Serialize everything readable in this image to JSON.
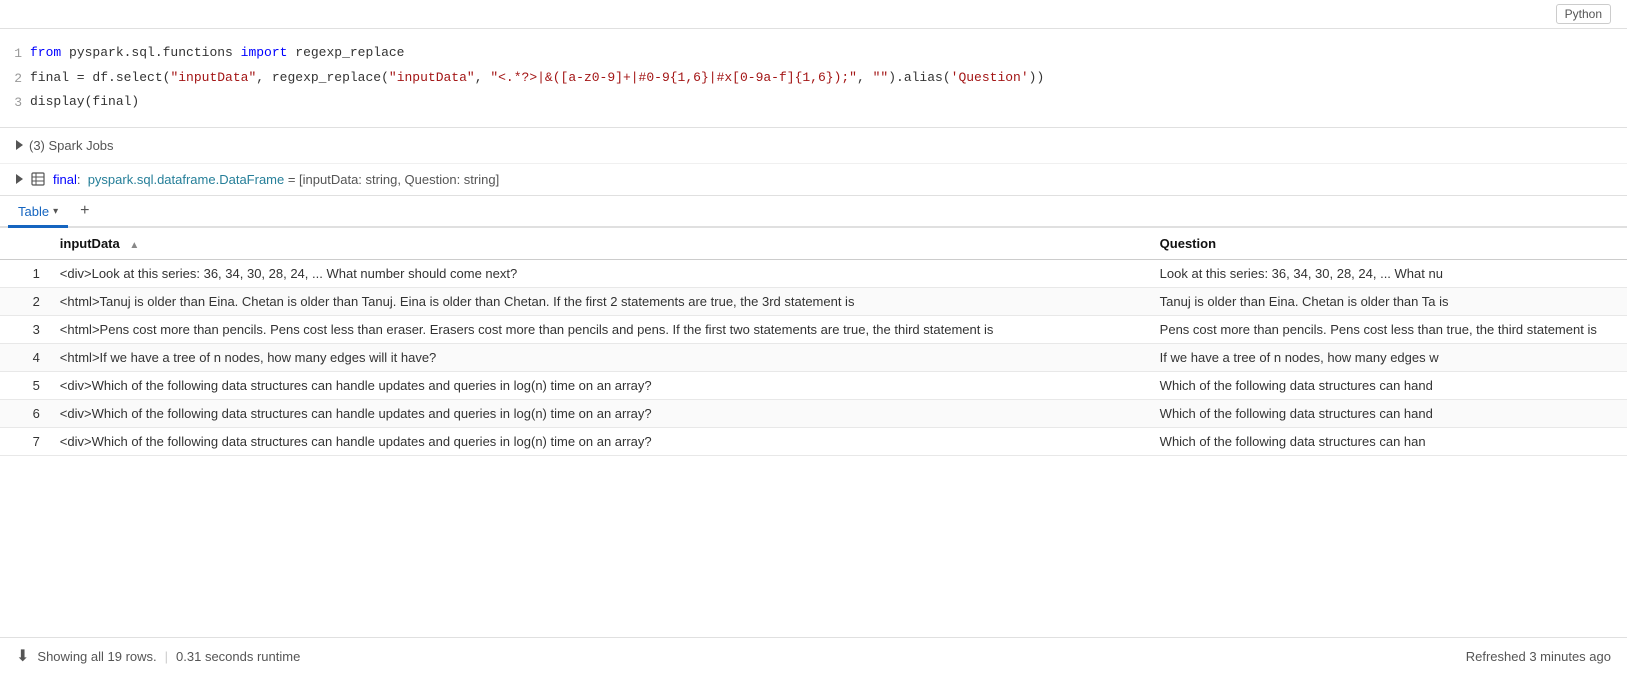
{
  "topbar": {
    "lang_label": "Python"
  },
  "code": {
    "lines": [
      {
        "num": "1",
        "parts": [
          {
            "text": "from ",
            "type": "keyword"
          },
          {
            "text": "pyspark.sql.functions ",
            "type": "module"
          },
          {
            "text": "import ",
            "type": "keyword"
          },
          {
            "text": "regexp_replace",
            "type": "plain"
          }
        ]
      },
      {
        "num": "2",
        "parts": [
          {
            "text": "final = df.select(",
            "type": "plain"
          },
          {
            "text": "\"inputData\"",
            "type": "string"
          },
          {
            "text": ", regexp_replace(",
            "type": "plain"
          },
          {
            "text": "\"inputData\"",
            "type": "string"
          },
          {
            "text": ", ",
            "type": "plain"
          },
          {
            "text": "\"<.*?>|&([a-z0-9]+|#0-9{1,6}|#x[0-9a-f]{1,6});\"",
            "type": "string"
          },
          {
            "text": ", ",
            "type": "plain"
          },
          {
            "text": "\"\"",
            "type": "string"
          },
          {
            "text": ").alias(",
            "type": "plain"
          },
          {
            "text": "'Question'",
            "type": "string"
          },
          {
            "text": "))",
            "type": "plain"
          }
        ]
      },
      {
        "num": "3",
        "parts": [
          {
            "text": "display(final)",
            "type": "plain"
          }
        ]
      }
    ]
  },
  "spark_jobs": {
    "label": "(3) Spark Jobs"
  },
  "df_info": {
    "label": "final:  pyspark.sql.dataframe.DataFrame = [inputData: string, Question: string]"
  },
  "tabs": {
    "active_tab": "Table",
    "chevron": "▾",
    "add": "+"
  },
  "table": {
    "columns": [
      {
        "id": "row_num",
        "label": ""
      },
      {
        "id": "inputData",
        "label": "inputData",
        "sortable": true
      },
      {
        "id": "question",
        "label": "Question",
        "sortable": false
      }
    ],
    "rows": [
      {
        "num": "1",
        "inputData": "<div>Look at this series: 36, 34, 30, 28, 24, ... What number should come next?",
        "question": "Look at this series: 36, 34, 30, 28, 24, ... What nu"
      },
      {
        "num": "2",
        "inputData": "<html>Tanuj is older than Eina. Chetan is older than Tanuj. Eina is older than Chetan. If the first 2 statements are true, the 3rd statement is",
        "question": "Tanuj is older than Eina. Chetan is older than Ta\nis"
      },
      {
        "num": "3",
        "inputData": "<html>Pens cost more than pencils. Pens cost less than eraser. Erasers cost more than pencils and pens. If the first two statements are true, the third statement is",
        "question": "Pens cost more than pencils. Pens cost less than\ntrue, the third statement is"
      },
      {
        "num": "4",
        "inputData": "<html>If we have a tree of n nodes, how many edges will it have?",
        "question": "If we have a tree of n nodes, how many edges w"
      },
      {
        "num": "5",
        "inputData": "<div>Which of the following data structures can handle updates and queries in log(n) time on an array?",
        "question": "Which of the following data structures can hand"
      },
      {
        "num": "6",
        "inputData": "<div>Which of the following data structures can handle updates and queries in log(n) time on an array?",
        "question": "Which of the following data structures can hand"
      },
      {
        "num": "7",
        "inputData": "<div>Which of the following data structures can handle updates and queries in log(n) time on an array?",
        "question": "Which of the following data structures can han"
      }
    ]
  },
  "footer": {
    "showing_text": "Showing all 19 rows.",
    "runtime": "0.31 seconds runtime",
    "refreshed": "Refreshed 3 minutes ago",
    "separator": "|"
  }
}
